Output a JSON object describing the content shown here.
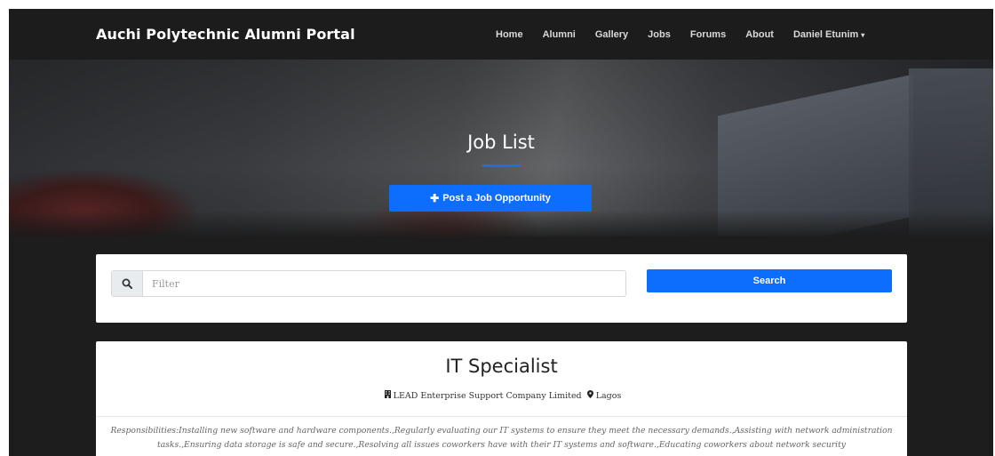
{
  "navbar": {
    "brand": "Auchi Polytechnic Alumni Portal",
    "items": [
      {
        "label": "Home"
      },
      {
        "label": "Alumni"
      },
      {
        "label": "Gallery"
      },
      {
        "label": "Jobs"
      },
      {
        "label": "Forums"
      },
      {
        "label": "About"
      }
    ],
    "user_menu": {
      "label": "Daniel Etunim",
      "caret": "▾"
    }
  },
  "hero": {
    "title": "Job List",
    "post_button": "Post a Job Opportunity",
    "post_button_icon": "plus-icon"
  },
  "search": {
    "placeholder": "Filter",
    "value": "",
    "button_label": "Search",
    "icon": "search-icon"
  },
  "job": {
    "title": "IT Specialist",
    "company": "LEAD Enterprise Support Company Limited",
    "location": "Lagos",
    "company_icon": "building-icon",
    "location_icon": "map-marker-icon",
    "description": "Responsibilities:Installing new software and hardware components.,Regularly evaluating our IT systems to ensure they meet the necessary demands.,Assisting with network administration tasks.,Ensuring data storage is safe and secure.,Resolving all issues coworkers have with their IT systems and software.,Educating coworkers about network security"
  },
  "colors": {
    "accent": "#0d6efd",
    "navbar_bg": "#1c1c1c",
    "page_bg": "#1d1d1d"
  }
}
